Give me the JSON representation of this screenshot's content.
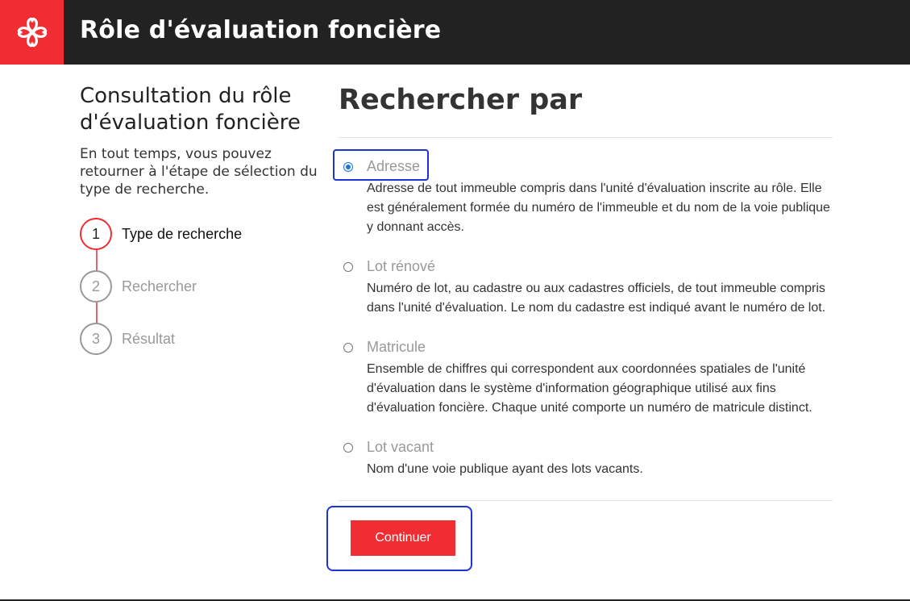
{
  "header": {
    "logo_icon": "montreal-rosette-icon",
    "title": "Rôle d'évaluation foncière",
    "brand_color": "#ef2d33",
    "bar_color": "#222222"
  },
  "sidebar": {
    "title": "Consultation du rôle d'évaluation foncière",
    "description": "En tout temps, vous pouvez retourner à l'étape de sélection du type de recherche.",
    "steps": [
      {
        "number": "1",
        "label": "Type de recherche",
        "state": "active"
      },
      {
        "number": "2",
        "label": "Rechercher",
        "state": "inactive"
      },
      {
        "number": "3",
        "label": "Résultat",
        "state": "inactive"
      }
    ]
  },
  "main": {
    "title": "Rechercher par",
    "options": [
      {
        "label": "Adresse",
        "checked": true,
        "description": "Adresse de tout immeuble compris dans l'unité d'évaluation inscrite au rôle. Elle est généralement formée du numéro de l'immeuble et du nom de la voie publique y donnant accès."
      },
      {
        "label": "Lot rénové",
        "checked": false,
        "description": "Numéro de lot, au cadastre ou aux cadastres officiels, de tout immeuble compris dans l'unité d'évaluation. Le nom du cadastre est indiqué avant le numéro de lot."
      },
      {
        "label": "Matricule",
        "checked": false,
        "description": "Ensemble de chiffres qui correspondent aux coordonnées spatiales de l'unité d'évaluation dans le système d'information géographique utilisé aux fins d'évaluation foncière. Chaque unité comporte un numéro de matricule distinct."
      },
      {
        "label": "Lot vacant",
        "checked": false,
        "description": "Nom d'une voie publique ayant des lots vacants."
      }
    ],
    "continue_label": "Continuer",
    "focus_color": "#1e33d6"
  }
}
